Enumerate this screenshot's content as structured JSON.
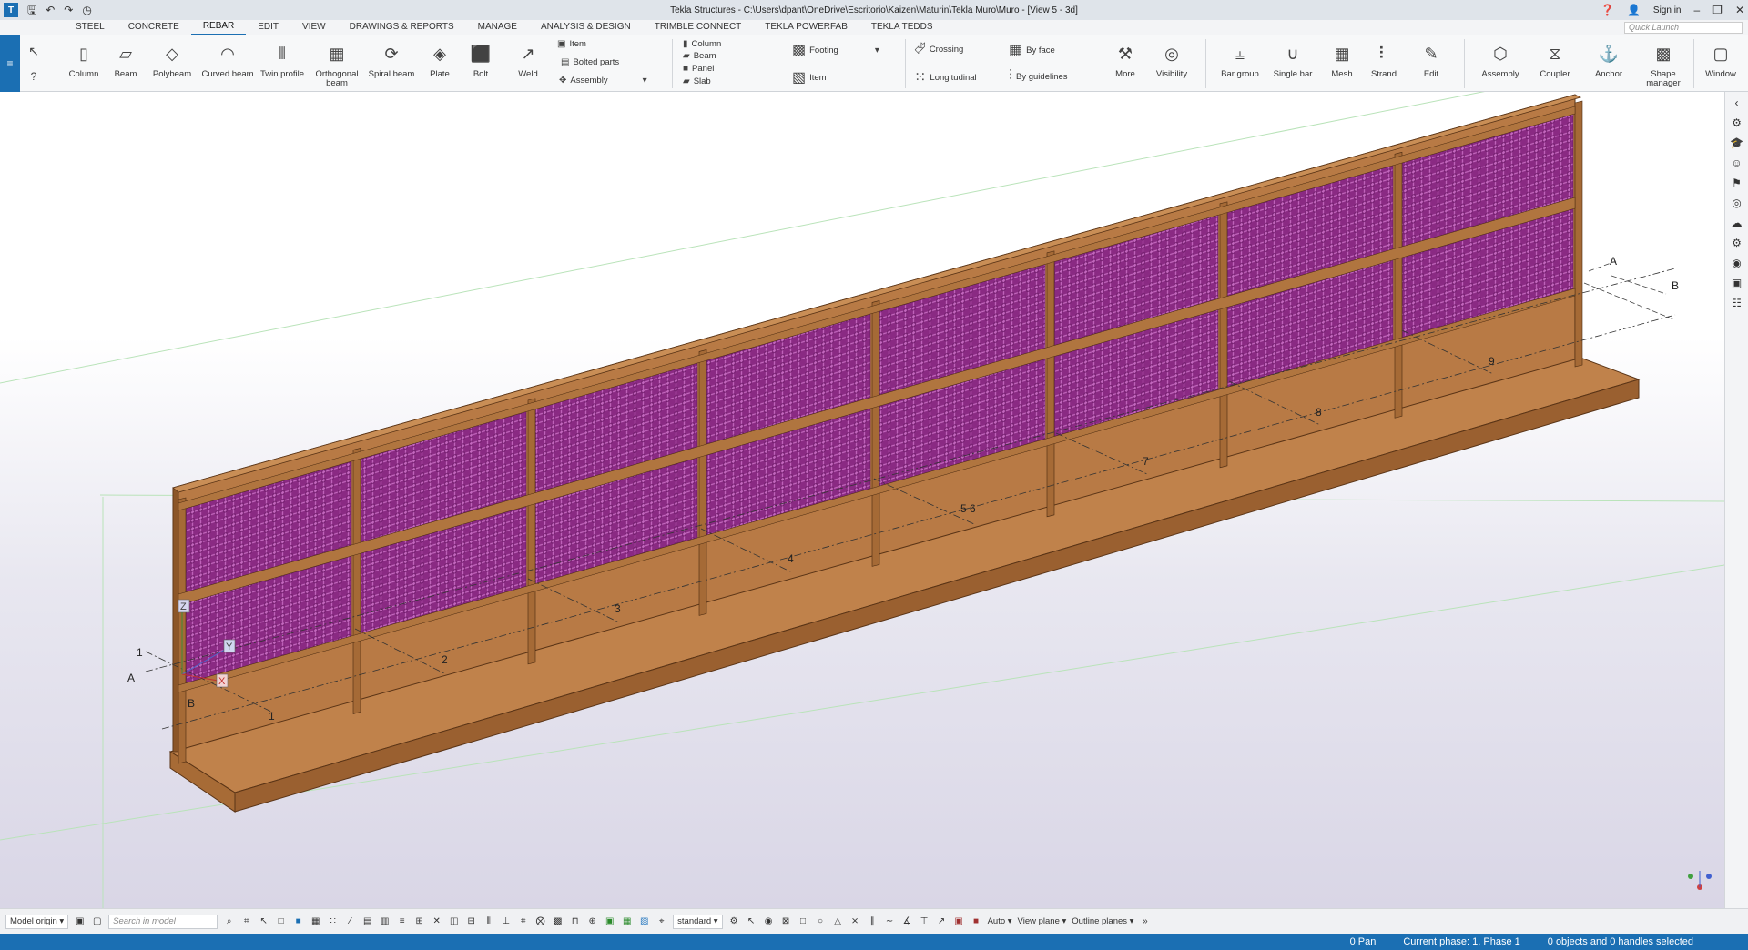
{
  "titlebar": {
    "title": "Tekla Structures - C:\\Users\\dpant\\OneDrive\\Escritorio\\Kaizen\\Maturin\\Tekla Muro\\Muro - [View 5 - 3d]",
    "sign_in": "Sign in",
    "help_icon": "help-icon"
  },
  "tabs": [
    "STEEL",
    "CONCRETE",
    "REBAR",
    "EDIT",
    "VIEW",
    "DRAWINGS & REPORTS",
    "MANAGE",
    "ANALYSIS & DESIGN",
    "TRIMBLE CONNECT",
    "TEKLA POWERFAB",
    "TEKLA TEDDS"
  ],
  "active_tab": "REBAR",
  "quick_launch_placeholder": "Quick Launch",
  "ribbon": {
    "column": "Column",
    "beam": "Beam",
    "polybeam": "Polybeam",
    "curved_beam": "Curved beam",
    "twin_profile": "Twin profile",
    "orthogonal_beam": "Orthogonal beam",
    "spiral_beam": "Spiral beam",
    "plate": "Plate",
    "bolt": "Bolt",
    "weld": "Weld",
    "item": "Item",
    "bolted_parts": "Bolted parts",
    "assembly_small": "Assembly",
    "c_column": "Column",
    "c_beam": "Beam",
    "c_panel": "Panel",
    "c_slab": "Slab",
    "footing": "Footing",
    "c_item": "Item",
    "crossing": "Crossing",
    "longitudinal": "Longitudinal",
    "by_face": "By face",
    "by_guidelines": "By guidelines",
    "more": "More",
    "visibility": "Visibility",
    "bar_group": "Bar group",
    "single_bar": "Single bar",
    "mesh": "Mesh",
    "strand": "Strand",
    "edit": "Edit",
    "assembly": "Assembly",
    "coupler": "Coupler",
    "anchor": "Anchor",
    "shape_manager": "Shape manager",
    "window": "Window"
  },
  "viewport": {
    "grid_numbers": [
      "1",
      "2",
      "3",
      "4",
      "5 6",
      "7",
      "8",
      "9"
    ],
    "grid_letters": [
      "A",
      "B"
    ],
    "left_grid_labels": [
      "1",
      "A",
      "B"
    ],
    "right_grid_labels": [
      "A",
      "B"
    ],
    "axis_labels": [
      "Z",
      "Y",
      "X"
    ],
    "concrete_color": "#b87a45",
    "mesh_color": "#8a2a83"
  },
  "bottombar": {
    "model_origin": "Model origin",
    "search_placeholder": "Search in model",
    "standard": "standard",
    "auto": "Auto",
    "view_plane": "View plane",
    "outline_planes": "Outline planes"
  },
  "status": {
    "pan": "0 Pan",
    "phase": "Current phase: 1, Phase 1",
    "selection": "0 objects and 0 handles selected"
  }
}
